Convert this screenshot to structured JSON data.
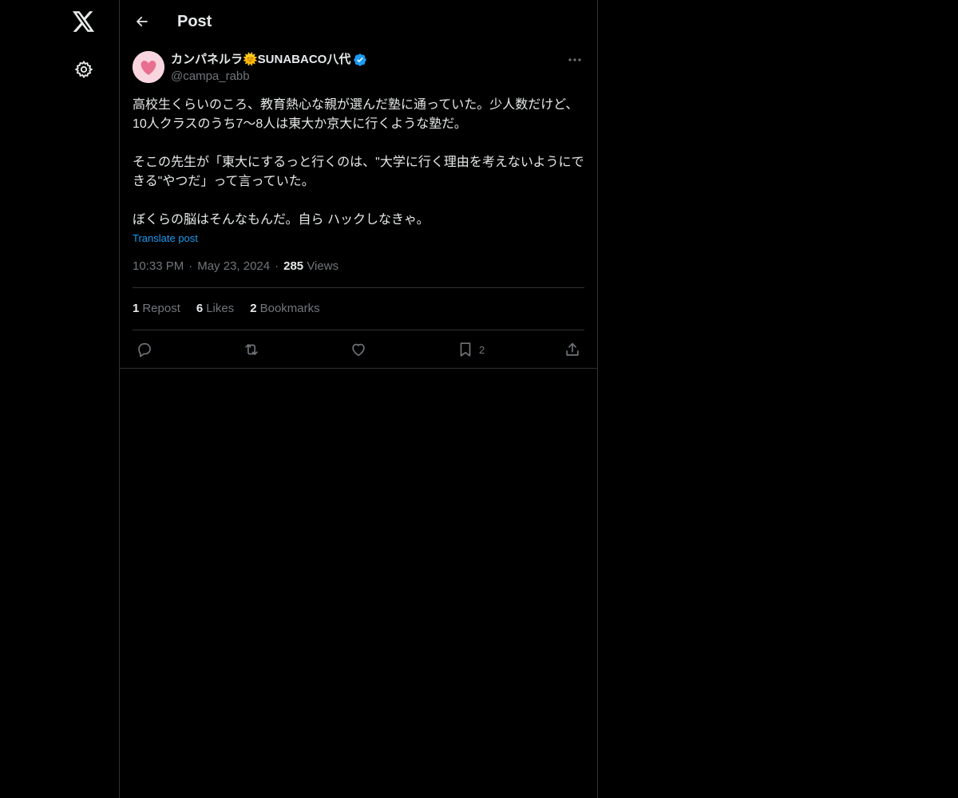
{
  "header": {
    "title": "Post"
  },
  "post": {
    "author_name": "カンパネルラ🌞SUNABACO八代",
    "handle": "@campa_rabb",
    "paragraphs": [
      "高校生くらいのころ、教育熱心な親が選んだ塾に通っていた。少人数だけど、10人クラスのうち7〜8人は東大か京大に行くような塾だ。",
      "そこの先生が「東大にするっと行くのは、\"大学に行く理由を考えないようにできる\"やつだ」って言っていた。",
      "ぼくらの脳はそんなもんだ。自ら ハックしなきゃ。"
    ],
    "translate_label": "Translate post",
    "time": "10:33 PM",
    "date": "May 23, 2024",
    "views_count": "285",
    "views_label": "Views",
    "separator": "·"
  },
  "stats": {
    "reposts_count": "1",
    "reposts_label": "Repost",
    "likes_count": "6",
    "likes_label": "Likes",
    "bookmarks_count": "2",
    "bookmarks_label": "Bookmarks"
  },
  "actions": {
    "bookmark_count": "2"
  },
  "icons": {
    "logo": "x-logo-icon",
    "settings": "gear-icon",
    "back": "arrow-left-icon",
    "more": "more-horizontal-icon",
    "verified": "verified-badge-icon",
    "reply": "reply-icon",
    "repost": "repost-icon",
    "like": "heart-icon",
    "bookmark": "bookmark-icon",
    "share": "share-icon"
  },
  "colors": {
    "background": "#000000",
    "text": "#e7e9ea",
    "muted": "#71767b",
    "accent": "#1d9bf0",
    "divider": "#2f3336"
  }
}
